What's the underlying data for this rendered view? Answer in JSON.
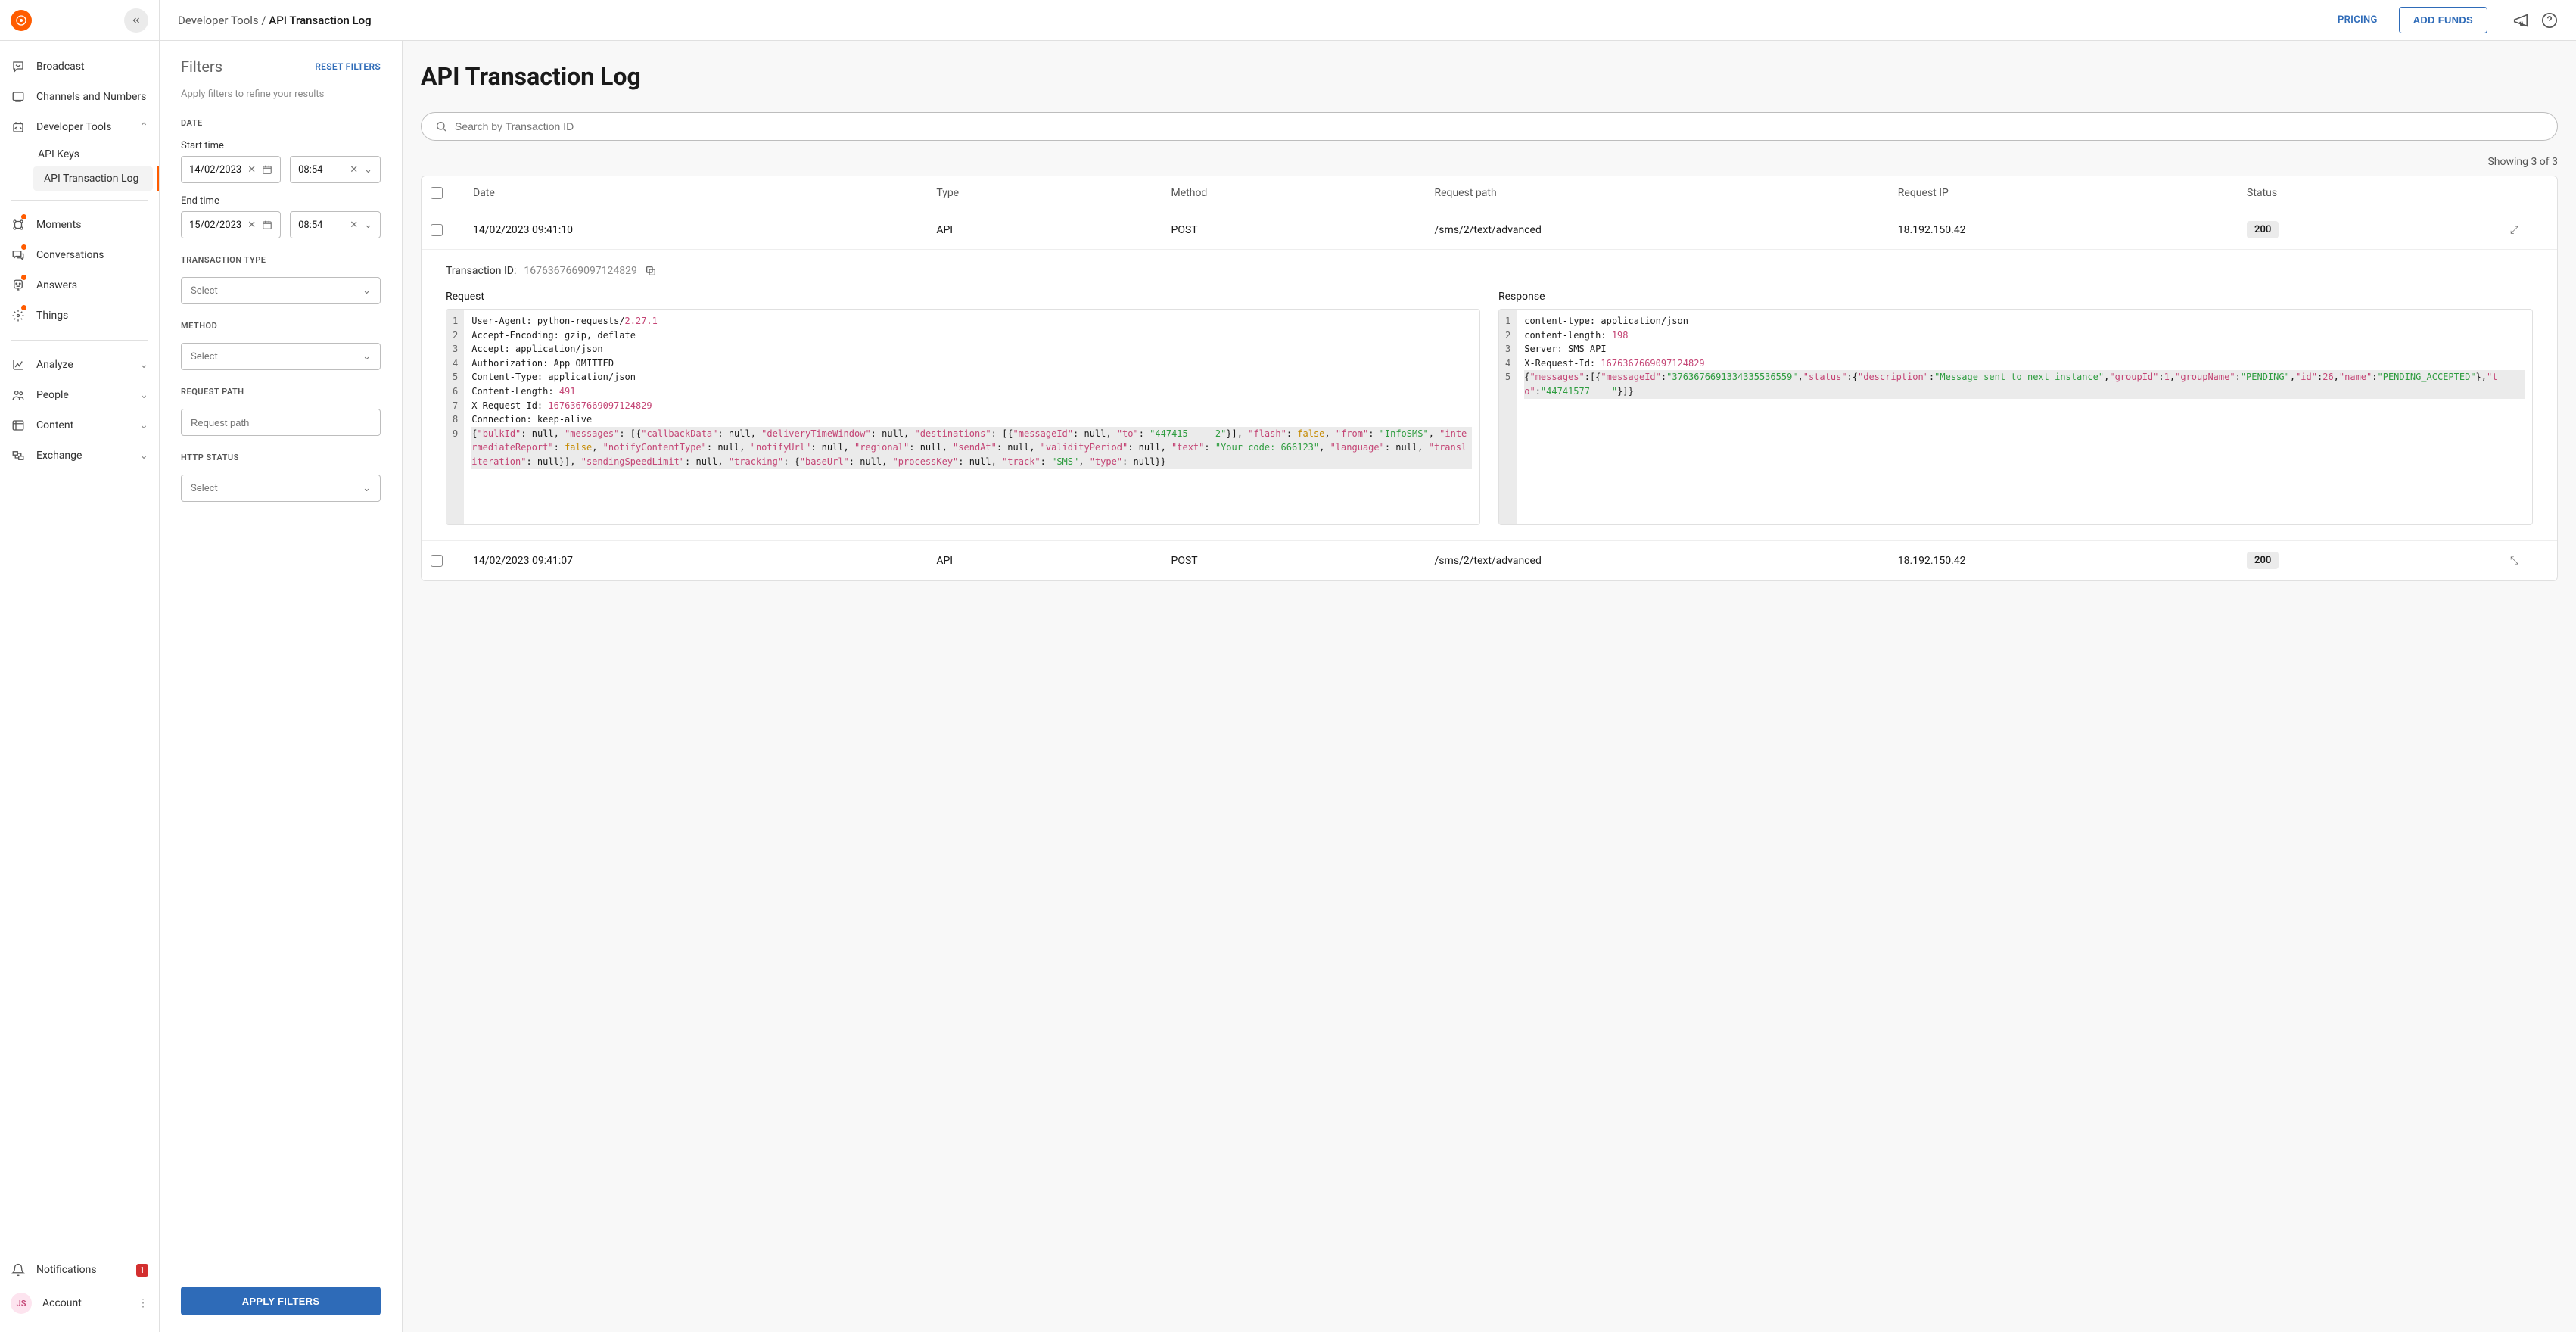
{
  "header": {
    "breadcrumb_parent": "Developer Tools",
    "breadcrumb_sep": " / ",
    "breadcrumb_current": "API Transaction Log",
    "pricing": "PRICING",
    "add_funds": "ADD FUNDS"
  },
  "sidebar": {
    "items": [
      {
        "label": "Broadcast",
        "icon": "broadcast"
      },
      {
        "label": "Channels and Numbers",
        "icon": "channels"
      },
      {
        "label": "Developer Tools",
        "icon": "devtools",
        "expanded": true,
        "children": [
          {
            "label": "API Keys"
          },
          {
            "label": "API Transaction Log",
            "active": true
          }
        ]
      },
      {
        "label": "Moments",
        "icon": "moments",
        "accent": true
      },
      {
        "label": "Conversations",
        "icon": "conversations",
        "accent": true
      },
      {
        "label": "Answers",
        "icon": "answers",
        "accent": true
      },
      {
        "label": "Things",
        "icon": "things",
        "accent": true
      },
      {
        "label": "Analyze",
        "icon": "analyze",
        "chev": true
      },
      {
        "label": "People",
        "icon": "people",
        "chev": true
      },
      {
        "label": "Content",
        "icon": "content",
        "chev": true
      },
      {
        "label": "Exchange",
        "icon": "exchange",
        "chev": true
      }
    ],
    "bottom": {
      "notifications": "Notifications",
      "notif_count": "1",
      "account": "Account",
      "avatar": "JS"
    }
  },
  "filters": {
    "title": "Filters",
    "reset": "RESET FILTERS",
    "sub": "Apply filters to refine your results",
    "date_label": "DATE",
    "start_label": "Start time",
    "start_date": "14/02/2023",
    "start_time": "08:54",
    "end_label": "End time",
    "end_date": "15/02/2023",
    "end_time": "08:54",
    "txn_type_label": "TRANSACTION TYPE",
    "method_label": "METHOD",
    "path_label": "REQUEST PATH",
    "path_placeholder": "Request path",
    "http_label": "HTTP STATUS",
    "select_placeholder": "Select",
    "apply": "APPLY FILTERS"
  },
  "log": {
    "title": "API Transaction Log",
    "search_placeholder": "Search by Transaction ID",
    "showing": "Showing 3 of 3",
    "cols": {
      "date": "Date",
      "type": "Type",
      "method": "Method",
      "path": "Request path",
      "ip": "Request IP",
      "status": "Status"
    },
    "rows": [
      {
        "date": "14/02/2023 09:41:10",
        "type": "API",
        "method": "POST",
        "path": "/sms/2/text/advanced",
        "ip": "18.192.150.42",
        "status": "200",
        "expanded": true
      },
      {
        "date": "14/02/2023 09:41:07",
        "type": "API",
        "method": "POST",
        "path": "/sms/2/text/advanced",
        "ip": "18.192.150.42",
        "status": "200"
      }
    ],
    "detail": {
      "txn_label": "Transaction ID: ",
      "txn_id": "1676367669097124829",
      "req_title": "Request",
      "res_title": "Response",
      "request_lines": [
        "User-Agent: python-requests/<n>2.27.1</n>",
        "Accept-Encoding: gzip, deflate",
        "Accept: application/json",
        "Authorization: App OMITTED",
        "Content-Type: application/json",
        "Content-Length: <n>491</n>",
        "X-Request-Id: <n>1676367669097124829</n>",
        "Connection: keep-alive",
        "{<k>\"bulkId\"</k>: null, <k>\"messages\"</k>: [{<k>\"callbackData\"</k>: null, <k>\"deliveryTimeWindow\"</k>: null, <k>\"destinations\"</k>: [{<k>\"messageId\"</k>: null, <k>\"to\"</k>: <s>\"447415     2\"</s>}], <k>\"flash\"</k>: <b>false</b>, <k>\"from\"</k>: <s>\"InfoSMS\"</s>, <k>\"intermediateReport\"</k>: <b>false</b>, <k>\"notifyContentType\"</k>: null, <k>\"notifyUrl\"</k>: null, <k>\"regional\"</k>: null, <k>\"sendAt\"</k>: null, <k>\"validityPeriod\"</k>: null, <k>\"text\"</k>: <s>\"Your code: 666123\"</s>, <k>\"language\"</k>: null, <k>\"transliteration\"</k>: null}], <k>\"sendingSpeedLimit\"</k>: null, <k>\"tracking\"</k>: {<k>\"baseUrl\"</k>: null, <k>\"processKey\"</k>: null, <k>\"track\"</k>: <s>\"SMS\"</s>, <k>\"type\"</k>: null}}"
      ],
      "response_lines": [
        "content-type: application/json",
        "content-length: <n>198</n>",
        "Server: SMS API",
        "X-Request-Id: <n>1676367669097124829</n>",
        "{<k>\"messages\"</k>:[{<k>\"messageId\"</k>:<s>\"3763676691334335536559\"</s>,<k>\"status\"</k>:{<k>\"description\"</k>:<s>\"Message sent to next instance\"</s>,<k>\"groupId\"</k>:<n>1</n>,<k>\"groupName\"</k>:<s>\"PENDING\"</s>,<k>\"id\"</k>:<n>26</n>,<k>\"name\"</k>:<s>\"PENDING_ACCEPTED\"</s>},<k>\"to\"</k>:<s>\"44741577    \"</s>}]}"
      ]
    }
  }
}
